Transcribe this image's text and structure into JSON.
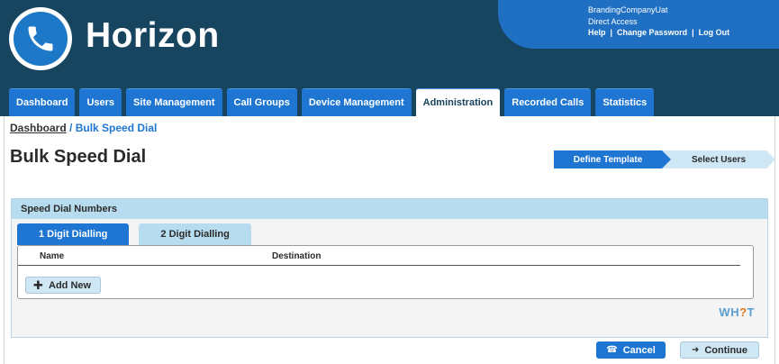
{
  "header": {
    "brand": "Horizon",
    "logo_icon": "phone-handset-icon",
    "account": {
      "company": "BrandingCompanyUat",
      "access": "Direct Access",
      "help": "Help",
      "change_password": "Change Password",
      "logout": "Log Out",
      "separator": "|"
    }
  },
  "nav": {
    "tabs": [
      {
        "label": "Dashboard"
      },
      {
        "label": "Users"
      },
      {
        "label": "Site Management"
      },
      {
        "label": "Call Groups"
      },
      {
        "label": "Device Management"
      },
      {
        "label": "Administration"
      },
      {
        "label": "Recorded Calls"
      },
      {
        "label": "Statistics"
      }
    ],
    "active": "Administration"
  },
  "breadcrumb": {
    "root": "Dashboard",
    "current": "/ Bulk Speed Dial"
  },
  "page_title": "Bulk Speed Dial",
  "wizard": {
    "steps": [
      "Define Template",
      "Select Users"
    ],
    "active_step": "Define Template"
  },
  "panel": {
    "title": "Speed Dial Numbers",
    "subtabs": [
      "1 Digit Dialling",
      "2 Digit Dialling"
    ],
    "active_subtab": "1 Digit Dialling",
    "columns": [
      "Name",
      "Destination"
    ],
    "add_label": "Add New"
  },
  "watermark": {
    "prefix": "WH",
    "mark": "?",
    "suffix": "T"
  },
  "actions": {
    "cancel": "Cancel",
    "continue": "Continue"
  },
  "colors": {
    "header_bg": "#17445f",
    "accent": "#1e76d2",
    "light_accent": "#cfe6f5"
  }
}
